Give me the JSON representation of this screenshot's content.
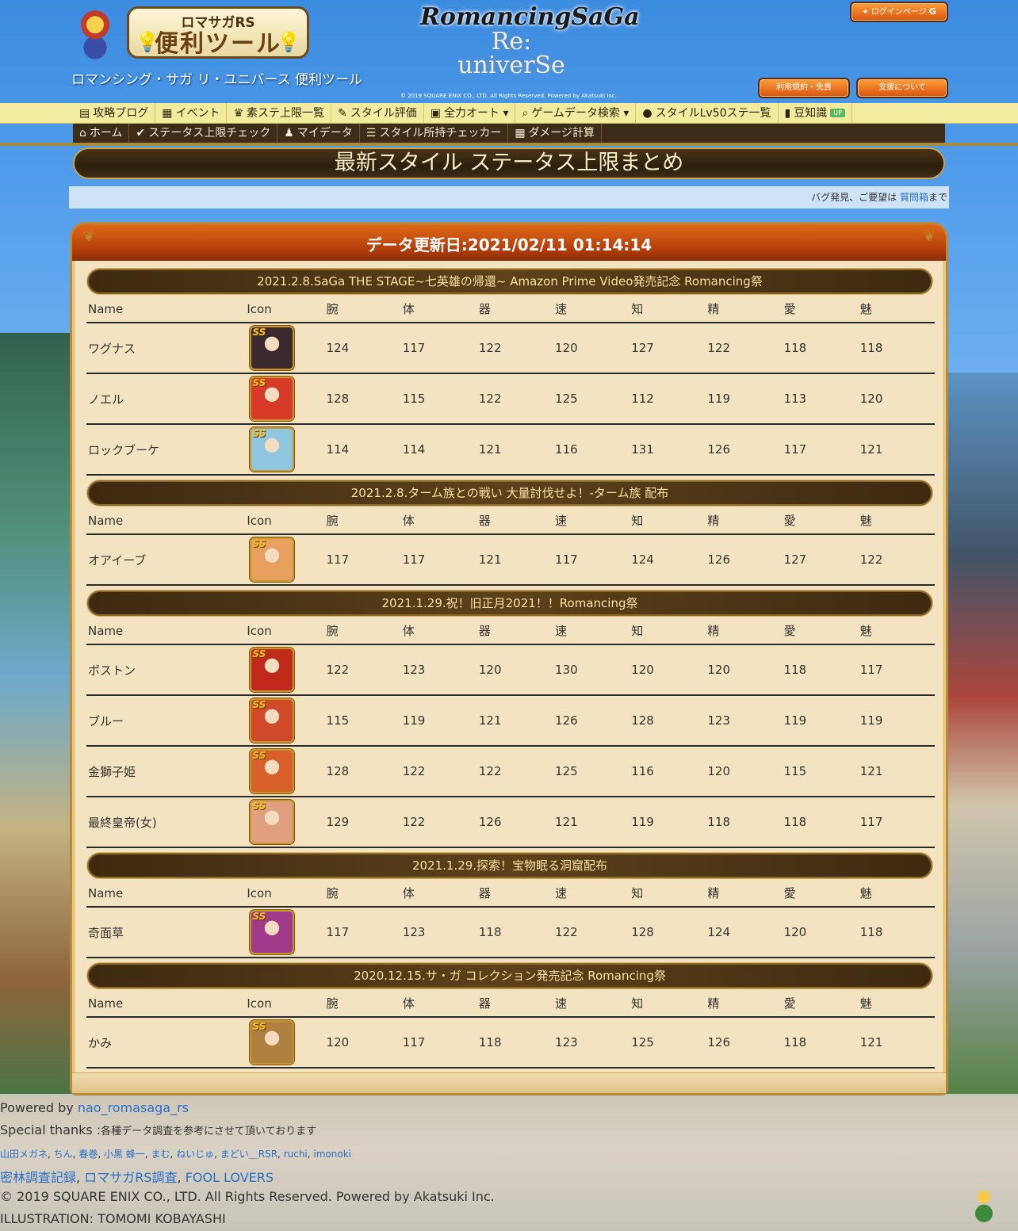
{
  "header": {
    "badge_line1": "ロマサガRS",
    "badge_line2": "便利ツール",
    "subtitle": "ロマンシング・サガ リ・ユニバース 便利ツール",
    "game_logo": {
      "line1": "RomancingSaGa",
      "line2": "Re:",
      "line3": "univerSe"
    },
    "copyright_small": "© 2019 SQUARE ENIX CO., LTD. All Rights Reserved. Powered by Akatsuki Inc.",
    "login_label": "ログインページ",
    "terms_label": "利用規約・免責",
    "support_label": "支援について"
  },
  "nav_top": [
    {
      "label": "攻略ブログ",
      "icon": "newspaper-icon",
      "glyph": "▤"
    },
    {
      "label": "イベント",
      "icon": "calendar-icon",
      "glyph": "▦"
    },
    {
      "label": "素ステ上限一覧",
      "icon": "crown-icon",
      "glyph": "♛"
    },
    {
      "label": "スタイル評価",
      "icon": "user-check-icon",
      "glyph": "✎"
    },
    {
      "label": "全力オート",
      "icon": "robot-icon",
      "glyph": "▣",
      "dropdown": true
    },
    {
      "label": "ゲームデータ検索",
      "icon": "search-icon",
      "glyph": "⌕",
      "dropdown": true
    },
    {
      "label": "スタイルLv50ステ一覧",
      "icon": "user-icon",
      "glyph": "●"
    },
    {
      "label": "豆知識",
      "icon": "book-icon",
      "glyph": "▮",
      "badge": "UP"
    }
  ],
  "nav_bottom": [
    {
      "label": "ホーム",
      "icon": "home-icon",
      "glyph": "⌂"
    },
    {
      "label": "ステータス上限チェック",
      "icon": "check-circle-icon",
      "glyph": "✔"
    },
    {
      "label": "マイデータ",
      "icon": "users-icon",
      "glyph": "♟"
    },
    {
      "label": "スタイル所持チェッカー",
      "icon": "list-check-icon",
      "glyph": "☰"
    },
    {
      "label": "ダメージ計算",
      "icon": "calculator-icon",
      "glyph": "▦"
    }
  ],
  "page_title": "最新スタイル ステータス上限まとめ",
  "notice": {
    "text": "バグ発見、ご要望は",
    "link": "質問箱",
    "suffix": "まで"
  },
  "panel_title": "データ更新日:2021/02/11 01:14:14",
  "columns": [
    "Name",
    "Icon",
    "腕",
    "体",
    "器",
    "速",
    "知",
    "精",
    "愛",
    "魅"
  ],
  "icon_badge": "SS",
  "sections": [
    {
      "title": "2021.2.8.SaGa THE STAGE~七英雄の帰還~ Amazon Prime Video発売記念 Romancing祭",
      "rows": [
        {
          "name": "ワグナス",
          "color": "#3a2a30",
          "stats": [
            "124",
            "117",
            "122",
            "120",
            "127",
            "122",
            "118",
            "118"
          ]
        },
        {
          "name": "ノエル",
          "color": "#d83a2a",
          "stats": [
            "128",
            "115",
            "122",
            "125",
            "112",
            "119",
            "113",
            "120"
          ]
        },
        {
          "name": "ロックブーケ",
          "color": "#8fc6e0",
          "stats": [
            "114",
            "114",
            "121",
            "116",
            "131",
            "126",
            "117",
            "121"
          ]
        }
      ]
    },
    {
      "title": "2021.2.8.ターム族との戦い 大量討伐せよ！-ターム族 配布",
      "rows": [
        {
          "name": "オアイーブ",
          "color": "#e8a060",
          "stats": [
            "117",
            "117",
            "121",
            "117",
            "124",
            "126",
            "127",
            "122"
          ]
        }
      ]
    },
    {
      "title": "2021.1.29.祝！旧正月2021！！Romancing祭",
      "rows": [
        {
          "name": "ボストン",
          "color": "#c02a1a",
          "stats": [
            "122",
            "123",
            "120",
            "130",
            "120",
            "120",
            "118",
            "117"
          ]
        },
        {
          "name": "ブルー",
          "color": "#d04a2a",
          "stats": [
            "115",
            "119",
            "121",
            "126",
            "128",
            "123",
            "119",
            "119"
          ]
        },
        {
          "name": "金獅子姫",
          "color": "#d8602a",
          "stats": [
            "128",
            "122",
            "122",
            "125",
            "116",
            "120",
            "115",
            "121"
          ]
        },
        {
          "name": "最終皇帝(女)",
          "color": "#e0a080",
          "stats": [
            "129",
            "122",
            "126",
            "121",
            "119",
            "118",
            "118",
            "117"
          ]
        }
      ]
    },
    {
      "title": "2021.1.29.探索！宝物眠る洞窟配布",
      "rows": [
        {
          "name": "奇面草",
          "color": "#a03a8a",
          "stats": [
            "117",
            "123",
            "118",
            "122",
            "128",
            "124",
            "120",
            "118"
          ]
        }
      ]
    },
    {
      "title": "2020.12.15.サ・ガ コレクション発売記念 Romancing祭",
      "rows": [
        {
          "name": "かみ",
          "color": "#b08040",
          "stats": [
            "120",
            "117",
            "118",
            "123",
            "125",
            "126",
            "118",
            "121"
          ]
        }
      ]
    }
  ],
  "footer": {
    "powered_prefix": "Powered by ",
    "powered_link": "nao_romasaga_rs",
    "thanks_prefix": "Special thanks :",
    "thanks_text": "各種データ調査を参考にさせて頂いております",
    "thanks_names": [
      "山田メガネ",
      "ちん",
      "春巻",
      "小黒 蜂一",
      "まむ",
      "ねいじゅ",
      "まどい＿RSR",
      "ruchi",
      "imonoki"
    ],
    "links": [
      "密林調査記録",
      "ロマサガRS調査",
      "FOOL LOVERS"
    ],
    "copyright": "© 2019 SQUARE ENIX CO., LTD. All Rights Reserved. Powered by Akatsuki Inc.",
    "illustration": "ILLUSTRATION: TOMOMI KOBAYASHI"
  }
}
